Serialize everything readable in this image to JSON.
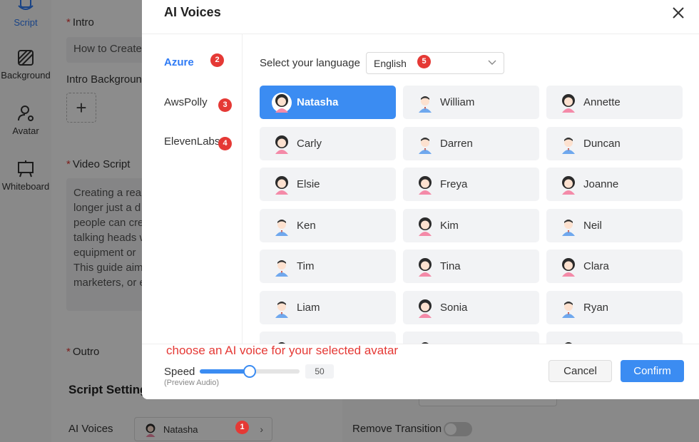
{
  "background": {
    "rail": [
      {
        "key": "script",
        "label": "Script"
      },
      {
        "key": "background",
        "label": "Background"
      },
      {
        "key": "avatar",
        "label": "Avatar"
      },
      {
        "key": "whiteboard",
        "label": "Whiteboard"
      }
    ],
    "intro_label": "Intro",
    "intro_value": "How to Create",
    "intro_background_label": "Intro Background",
    "video_script_label": "Video Script",
    "video_script_lines": [
      "Creating a real",
      "longer just a d",
      "people can cre",
      "talking heads w",
      "equipment or",
      "This guide aim",
      "marketers, or e"
    ],
    "outro_label": "Outro",
    "settings_title": "Script Setting",
    "ai_voices_label": "AI Voices",
    "ai_voices_value": "Natasha",
    "remove_transition_label": "Remove Transition"
  },
  "modal": {
    "title": "AI Voices",
    "providers": [
      {
        "label": "Azure",
        "badge": "2",
        "active": true
      },
      {
        "label": "AwsPolly",
        "badge": "3",
        "active": false
      },
      {
        "label": "ElevenLabs",
        "badge": "4",
        "active": false
      }
    ],
    "language_label": "Select your language",
    "language_value": "English",
    "language_badge": "5",
    "voices": [
      {
        "name": "Natasha",
        "gender": "female",
        "selected": true
      },
      {
        "name": "William",
        "gender": "male"
      },
      {
        "name": "Annette",
        "gender": "female"
      },
      {
        "name": "Carly",
        "gender": "female"
      },
      {
        "name": "Darren",
        "gender": "male"
      },
      {
        "name": "Duncan",
        "gender": "male"
      },
      {
        "name": "Elsie",
        "gender": "female"
      },
      {
        "name": "Freya",
        "gender": "female"
      },
      {
        "name": "Joanne",
        "gender": "female"
      },
      {
        "name": "Ken",
        "gender": "male"
      },
      {
        "name": "Kim",
        "gender": "female"
      },
      {
        "name": "Neil",
        "gender": "male"
      },
      {
        "name": "Tim",
        "gender": "male"
      },
      {
        "name": "Tina",
        "gender": "female"
      },
      {
        "name": "Clara",
        "gender": "female"
      },
      {
        "name": "Liam",
        "gender": "male"
      },
      {
        "name": "Sonia",
        "gender": "female"
      },
      {
        "name": "Ryan",
        "gender": "male"
      },
      {
        "name": "",
        "gender": "male"
      },
      {
        "name": "",
        "gender": "male"
      },
      {
        "name": "",
        "gender": "male"
      }
    ],
    "hint": "choose an AI voice for your selected avatar",
    "speed_label": "Speed",
    "speed_sub": "(Preview Audio)",
    "speed_value": "50",
    "speed_fraction": 0.5,
    "cancel_label": "Cancel",
    "confirm_label": "Confirm",
    "ai_voices_badge": "1"
  },
  "colors": {
    "accent": "#3b8cf2",
    "badge": "#e53935",
    "female_hair": "#2b2b2b",
    "female_shirt": "#f48aa8",
    "male_shirt": "#6fa8ee",
    "skin": "#fde1cf"
  }
}
